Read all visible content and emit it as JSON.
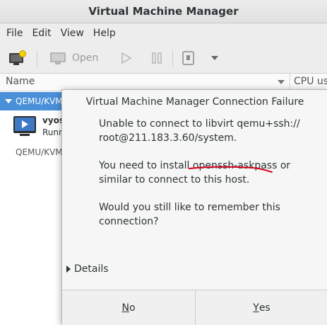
{
  "window": {
    "title": "Virtual Machine Manager"
  },
  "menu": [
    "File",
    "Edit",
    "View",
    "Help"
  ],
  "toolbar": {
    "open_label": "Open"
  },
  "columns": {
    "name": "Name",
    "cpu": "CPU us"
  },
  "connections": [
    {
      "label": "QEMU/KVM"
    },
    {
      "label": "QEMU/KVM:"
    }
  ],
  "vm": {
    "name": "vyos",
    "state": "Runn"
  },
  "dialog": {
    "title": "Virtual Machine Manager Connection Failure",
    "line1a": "Unable to connect to libvirt qemu+ssh://",
    "line1b": "root@211.183.3.60/system.",
    "line2a_pre": "You need to install ",
    "line2a_pkg": "openssh-askpass",
    "line2a_post": " or",
    "line2b": "similar to connect to this host.",
    "line3a": "Would you still like to remember this",
    "line3b": "connection?",
    "details_label": "Details",
    "no_mnemonic": "N",
    "no_rest": "o",
    "yes_mnemonic": "Y",
    "yes_rest": "es"
  },
  "colors": {
    "selection": "#4a90d9",
    "annotation": "#d0021b"
  }
}
